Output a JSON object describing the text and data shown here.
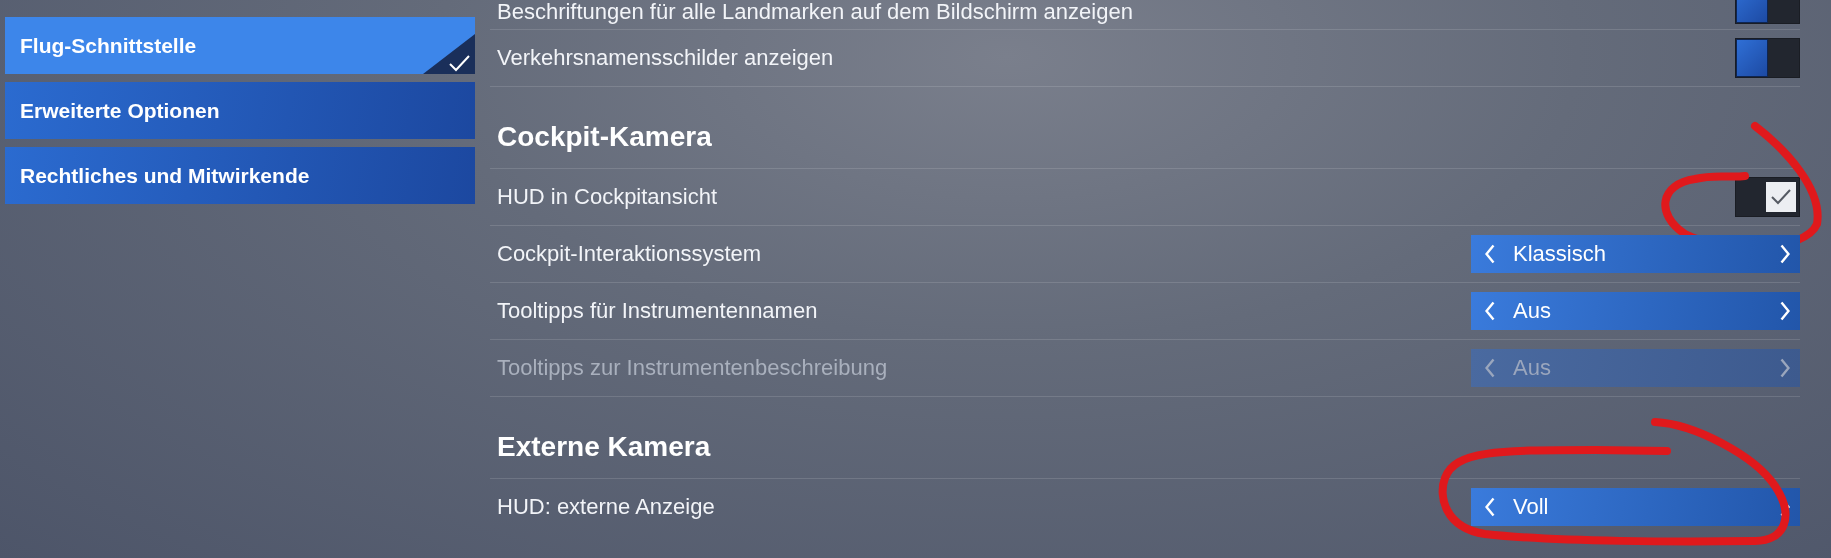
{
  "sidebar": {
    "items": [
      {
        "label": "Flug-Schnittstelle",
        "selected": true
      },
      {
        "label": "Erweiterte Optionen",
        "selected": false
      },
      {
        "label": "Rechtliches und Mitwirkende",
        "selected": false
      }
    ]
  },
  "settings": [
    {
      "kind": "toggle",
      "label": "Beschriftungen für alle Landmarken auf dem Bildschirm anzeigen",
      "checked": false,
      "circled": false
    },
    {
      "kind": "toggle",
      "label": "Verkehrsnamensschilder anzeigen",
      "checked": false,
      "circled": false
    },
    {
      "kind": "heading",
      "label": "Cockpit-Kamera"
    },
    {
      "kind": "toggle",
      "label": "HUD in Cockpitansicht",
      "checked": true,
      "circled": true
    },
    {
      "kind": "selector",
      "label": "Cockpit-Interaktionssystem",
      "value": "Klassisch",
      "disabled": false,
      "circled": false
    },
    {
      "kind": "selector",
      "label": "Tooltipps für Instrumentennamen",
      "value": "Aus",
      "disabled": false,
      "circled": false
    },
    {
      "kind": "selector",
      "label": "Tooltipps zur Instrumentenbeschreibung",
      "value": "Aus",
      "disabled": true,
      "circled": false
    },
    {
      "kind": "heading",
      "label": "Externe Kamera"
    },
    {
      "kind": "selector",
      "label": "HUD: externe Anzeige",
      "value": "Voll",
      "disabled": false,
      "circled": true
    }
  ]
}
